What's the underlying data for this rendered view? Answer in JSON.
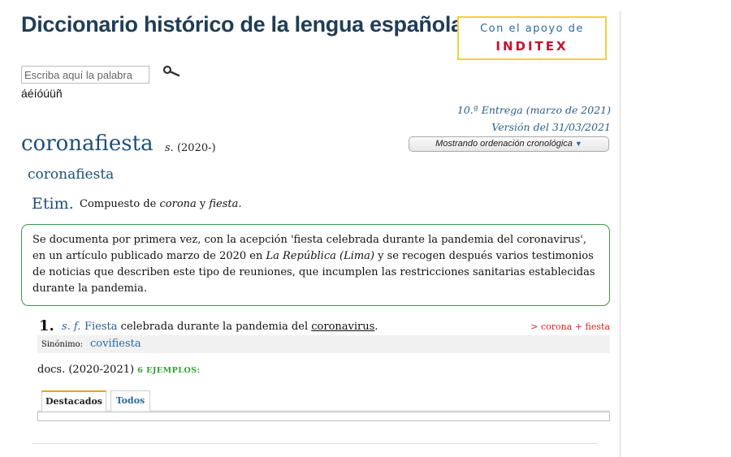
{
  "header": {
    "title": "Diccionario histórico de la lengua española",
    "sponsor_line1": "Con el apoyo de",
    "sponsor_line2": "INDITEX",
    "search_placeholder": "Escriba aquí la palabra",
    "accent_chars": "áéíóúüñ"
  },
  "meta": {
    "entrega": "10.ª Entrega (marzo de 2021)",
    "version": "Versión del 31/03/2021",
    "ordering": "Mostrando ordenación cronológica"
  },
  "entry": {
    "headword": "coronafiesta",
    "pos_abbr": "s.",
    "pos_date": "(2020-)",
    "subheadword": "coronafiesta",
    "etim_label": "Etim.",
    "etim_pre": "Compuesto de ",
    "etim_w1": "corona",
    "etim_mid": " y ",
    "etim_w2": "fiesta",
    "etim_post": ".",
    "note_part1": "Se documenta por primera vez, con la acepción 'fiesta celebrada durante la pandemia del coronavirus', en un artículo publicado marzo de 2020 en ",
    "note_italic": "La República (Lima)",
    "note_part2": " y se recogen después varios testimonios de noticias que describen este tipo de reuniones, que incumplen las restricciones sanitarias establecidas durante la pandemia."
  },
  "sense": {
    "number": "1.",
    "gram": "s. f.",
    "def_link": "Fiesta",
    "def_mid": " celebrada durante la pandemia del ",
    "def_underlined": "coronavirus",
    "def_end": ".",
    "etym_right": "> corona + fiesta",
    "syn_label": "Sinónimo:",
    "syn_value": "covifiesta"
  },
  "docs": {
    "text": "docs. (2020-2021)",
    "examples": "6 EJEMPLOS:"
  },
  "tabs": {
    "featured": "Destacados",
    "all": "Todos"
  },
  "colors": {
    "title": "#1f3d55",
    "link_blue": "#2a5e8c",
    "note_border": "#3a9a4a",
    "sponsor_border": "#f2d13c",
    "sponsor_red": "#c8102e",
    "etym_red": "#e02020",
    "examples_green": "#2fa32f",
    "tab_active": "#e8a700"
  }
}
